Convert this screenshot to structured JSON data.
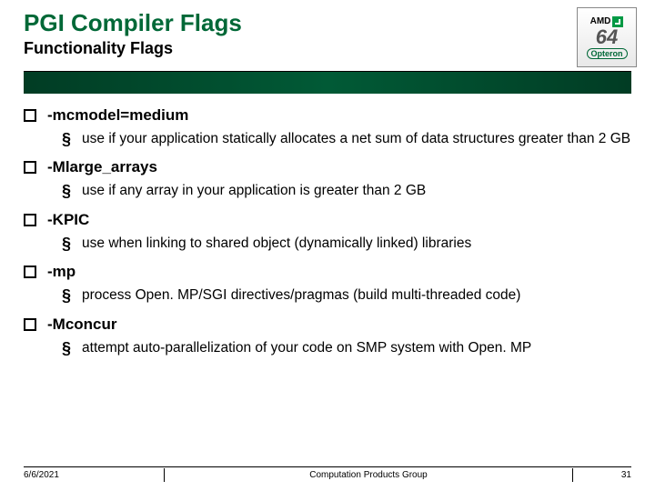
{
  "header": {
    "title": "PGI Compiler Flags",
    "subtitle": "Functionality Flags"
  },
  "logo": {
    "brand": "AMD",
    "number": "64",
    "product": "Opteron"
  },
  "items": [
    {
      "flag": "-mcmodel=medium",
      "desc": "use if your application statically allocates a net sum of data structures greater than 2 GB"
    },
    {
      "flag": "-Mlarge_arrays",
      "desc": "use if any array in your application is greater than 2 GB"
    },
    {
      "flag": "-KPIC",
      "desc": "use when linking to shared object (dynamically linked) libraries"
    },
    {
      "flag": "-mp",
      "desc": "process Open. MP/SGI directives/pragmas (build multi-threaded code)"
    },
    {
      "flag": "-Mconcur",
      "desc": "attempt auto-parallelization of your code on SMP system with Open. MP"
    }
  ],
  "footer": {
    "date": "6/6/2021",
    "group": "Computation Products Group",
    "page": "31"
  }
}
